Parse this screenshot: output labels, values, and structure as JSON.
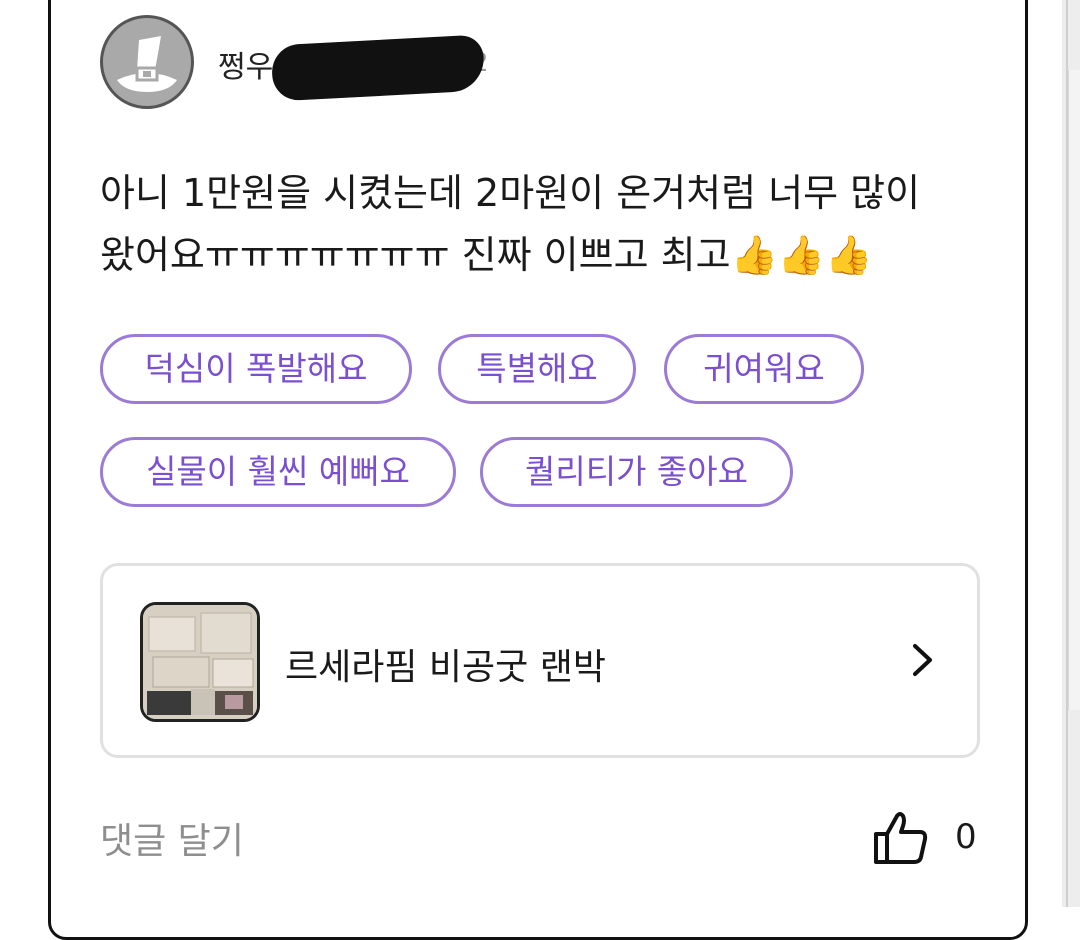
{
  "review": {
    "username_visible": "쩡우",
    "username_tail": "2",
    "text_line1": "아니 1만원을 시켰는데 2마원이 온거처럼 너무 많이",
    "text_line2": "왔어요ㅠㅠㅠㅠㅠㅠㅠ 진짜 이쁘고 최고👍👍👍"
  },
  "tags": [
    {
      "label": "덕심이 폭발해요"
    },
    {
      "label": "특별해요"
    },
    {
      "label": "귀여워요"
    },
    {
      "label": "실물이 훨씬 예뻐요"
    },
    {
      "label": "퀄리티가 좋아요"
    }
  ],
  "product": {
    "name": "르세라핌 비공굿 랜박"
  },
  "footer": {
    "comment_label": "댓글 달기",
    "like_count": "0"
  },
  "colors": {
    "chip_border": "#9b7bd6",
    "chip_text": "#7a4fd0",
    "muted_text": "#8e8e8e"
  },
  "icons": {
    "avatar": "hat-avatar-icon",
    "chevron": "chevron-right-icon",
    "like": "thumbs-up-icon"
  }
}
